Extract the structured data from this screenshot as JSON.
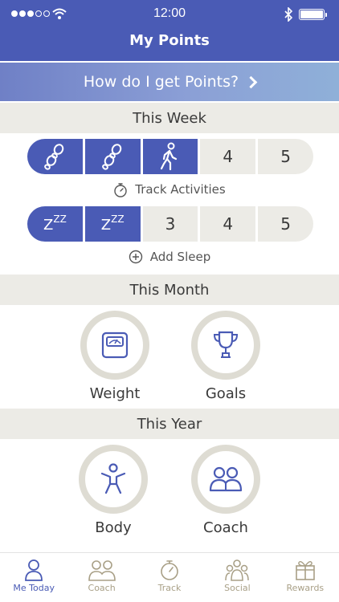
{
  "status_bar": {
    "time": "12:00"
  },
  "nav": {
    "title": "My Points"
  },
  "banner": {
    "label": "How do I get Points?"
  },
  "this_week": {
    "title": "This Week",
    "activity_slots": [
      {
        "label": "",
        "filled": true,
        "icon": "footprints-icon"
      },
      {
        "label": "",
        "filled": true,
        "icon": "footprints-icon"
      },
      {
        "label": "",
        "filled": true,
        "icon": "walking-person-icon"
      },
      {
        "label": "4",
        "filled": false
      },
      {
        "label": "5",
        "filled": false
      }
    ],
    "activity_action": "Track Activities",
    "sleep_slots": [
      {
        "label": "",
        "filled": true,
        "icon": "zzz-icon"
      },
      {
        "label": "",
        "filled": true,
        "icon": "zzz-icon"
      },
      {
        "label": "3",
        "filled": false
      },
      {
        "label": "4",
        "filled": false
      },
      {
        "label": "5",
        "filled": false
      }
    ],
    "sleep_action": "Add Sleep"
  },
  "this_month": {
    "title": "This Month",
    "badges": [
      {
        "name": "Weight",
        "icon": "scale-icon"
      },
      {
        "name": "Goals",
        "icon": "trophy-icon"
      }
    ]
  },
  "this_year": {
    "title": "This Year",
    "badges": [
      {
        "name": "Body",
        "icon": "person-icon"
      },
      {
        "name": "Coach",
        "icon": "coach-icon"
      }
    ]
  },
  "tabs": [
    {
      "label": "Me Today",
      "icon": "person-outline-icon",
      "active": true
    },
    {
      "label": "Coach",
      "icon": "coach-outline-icon",
      "active": false
    },
    {
      "label": "Track",
      "icon": "stopwatch-icon",
      "active": false
    },
    {
      "label": "Social",
      "icon": "group-icon",
      "active": false
    },
    {
      "label": "Rewards",
      "icon": "gift-icon",
      "active": false
    }
  ],
  "colors": {
    "brand": "#4a5bb5",
    "neutral": "#ecebe6",
    "ring": "#dedcd3",
    "tab_inactive": "#a89f86"
  }
}
